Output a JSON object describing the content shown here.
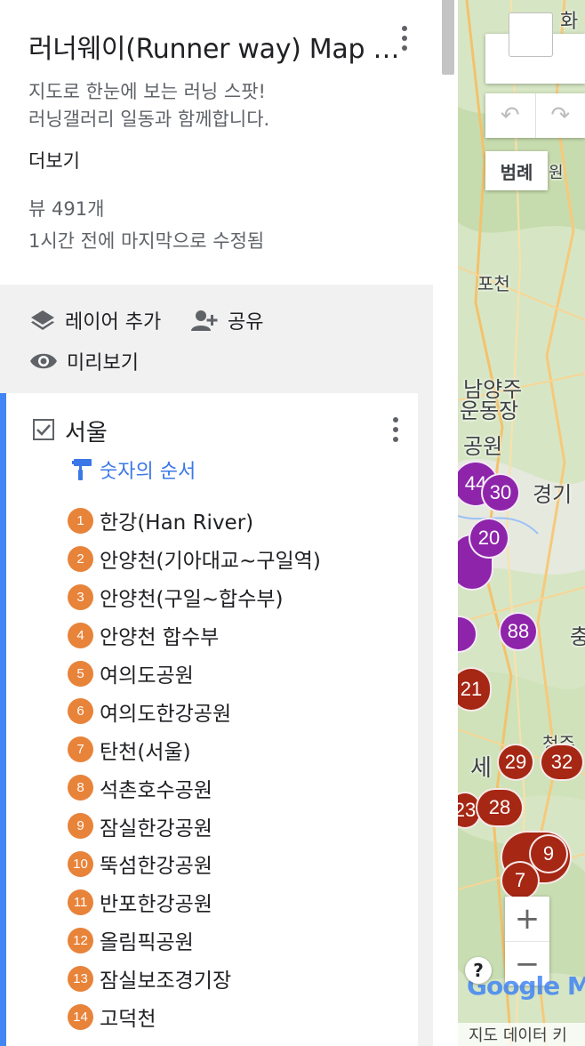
{
  "header": {
    "title": "러너웨이(Runner way) Map - 대한민국 러닝 지도",
    "description": [
      "지도로 한눈에 보는 러닝 스팟!",
      "러닝갤러리 일동과 함께합니다."
    ],
    "more_link": "더보기",
    "views": "뷰 491개",
    "modified": "1시간 전에 마지막으로 수정됨"
  },
  "actions": {
    "add_layer": "레이어 추가",
    "share": "공유",
    "preview": "미리보기"
  },
  "layer": {
    "title": "서울",
    "checked": true,
    "style_label": "숫자의 순서",
    "places": [
      {
        "num": "1",
        "label": "한강(Han River)"
      },
      {
        "num": "2",
        "label": "안양천(기아대교~구일역)"
      },
      {
        "num": "3",
        "label": "안양천(구일~합수부)"
      },
      {
        "num": "4",
        "label": "안양천 합수부"
      },
      {
        "num": "5",
        "label": "여의도공원"
      },
      {
        "num": "6",
        "label": "여의도한강공원"
      },
      {
        "num": "7",
        "label": "탄천(서울)"
      },
      {
        "num": "8",
        "label": "석촌호수공원"
      },
      {
        "num": "9",
        "label": "잠실한강공원"
      },
      {
        "num": "10",
        "label": "뚝섬한강공원"
      },
      {
        "num": "11",
        "label": "반포한강공원"
      },
      {
        "num": "12",
        "label": "올림픽공원"
      },
      {
        "num": "13",
        "label": "잠실보조경기장"
      },
      {
        "num": "14",
        "label": "고덕천"
      }
    ],
    "badge_color": "#e8833a",
    "accent_color": "#4285f4"
  },
  "map": {
    "labels": {
      "hwa": "화",
      "won": "원",
      "pocheon": "포천",
      "namyangju": "남양주",
      "undongjang": "운동장",
      "gongwon": "공원",
      "gyeonggi": "경기",
      "chung": "충",
      "se": "세",
      "cheongju": "청주",
      "ki": "키"
    },
    "clusters": [
      {
        "label": "44",
        "color": "purple"
      },
      {
        "label": "30",
        "color": "purple"
      },
      {
        "label": "20",
        "color": "purple"
      },
      {
        "label": "88",
        "color": "purple"
      },
      {
        "label": "21",
        "color": "red"
      },
      {
        "label": "29",
        "color": "red"
      },
      {
        "label": "32",
        "color": "red"
      },
      {
        "label": "28",
        "color": "red"
      },
      {
        "label": "23",
        "color": "red"
      },
      {
        "label": "9",
        "color": "red"
      },
      {
        "label": "7",
        "color": "red"
      }
    ],
    "legend_button": "범례",
    "zoom_in": "+",
    "zoom_out": "−",
    "help": "?",
    "logo": "Google My Maps",
    "map_data": "지도 데이터"
  }
}
